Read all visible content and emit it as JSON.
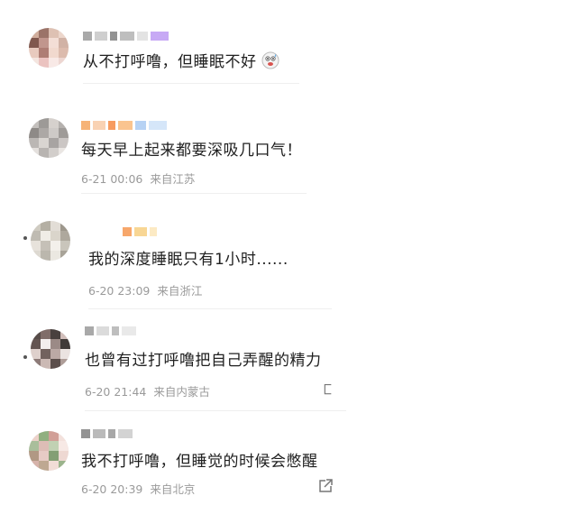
{
  "comments": [
    {
      "text": "从不打呼噜，但睡眠不好",
      "emoji": "grinning-sweat-emoji",
      "time": "",
      "location": "",
      "avatar_colors": [
        "#c9a08c",
        "#8a5b4e",
        "#d9b7a6",
        "#e9cfc2",
        "#6a3b30",
        "#b7847a",
        "#f1d9cf",
        "#caa596",
        "#e4c1b3",
        "#a0675c",
        "#efd3c6",
        "#d7b09f",
        "#f3e1da",
        "#e8b9b6",
        "#f7e6e2",
        "#ebcfc9"
      ],
      "name_colors": [
        "#8c8c8c",
        "#bfbfbf",
        "#6f6f6f",
        "#a8a8a8",
        "#d9d9d9",
        "#b48cf2"
      ]
    },
    {
      "text": "每天早上起来都要深吸几口气！",
      "time": "6-21 00:06",
      "location": "来自江苏",
      "avatar_colors": [
        "#b9b4b1",
        "#8d8986",
        "#cfc9c5",
        "#a9a4a1",
        "#7b7673",
        "#9e9996",
        "#c6c1be",
        "#8f8a87",
        "#b0aba8",
        "#d3ceca",
        "#9a9592",
        "#c2bdba",
        "#e0dbd8",
        "#aca7a4",
        "#cbc6c3",
        "#e7e2df"
      ],
      "name_colors": [
        "#f39a4a",
        "#f7c39a",
        "#f47a2a",
        "#f8b06a",
        "#9dc3f0",
        "#c7ddf7"
      ]
    },
    {
      "text": "我的深度睡眠只有1小时......",
      "time": "6-20 23:09",
      "location": "来自浙江",
      "avatar_colors": [
        "#c7c2b7",
        "#a8a294",
        "#ddd8cf",
        "#8c8679",
        "#b5b0a5",
        "#eeeae2",
        "#d4cec3",
        "#a09a8d",
        "#e3ded5",
        "#bbb6ab",
        "#f2eee8",
        "#c0bbb0",
        "#d8d3ca",
        "#b0ab9f",
        "#e8e4dc",
        "#9a9487"
      ],
      "name_colors": [
        "#f48a3a",
        "#f6c870",
        "#fbe3b0"
      ]
    },
    {
      "text": "也曾有过打呼噜把自己弄醒的精力",
      "time": "6-20 21:44",
      "location": "来自内蒙古",
      "avatar_colors": [
        "#3a2d2a",
        "#6b5450",
        "#2a1f1d",
        "#c9b3ae",
        "#4a3834",
        "#f2ecea",
        "#8a7671",
        "#1f1816",
        "#d9c8c4",
        "#5a4743",
        "#b09b96",
        "#e8dfdc",
        "#7a6561",
        "#c2ada8",
        "#3f302c",
        "#a18c87"
      ],
      "name_colors": [
        "#8c8c8c",
        "#cfcfcf",
        "#a8a8a8",
        "#e2e2e2"
      ]
    },
    {
      "text": "我不打呼噜，但睡觉的时候会憋醒",
      "time": "6-20 20:39",
      "location": "来自北京",
      "avatar_colors": [
        "#e9c9c0",
        "#7da26a",
        "#c98f86",
        "#f2dcd6",
        "#9bb38a",
        "#d8b2aa",
        "#b7c9a6",
        "#f6e6e1",
        "#a4876f",
        "#e3c3bb",
        "#6f8f5c",
        "#ecd2cb",
        "#cfa69c",
        "#b39a7f",
        "#f0d8d1",
        "#8aa878"
      ],
      "name_colors": [
        "#6f6f6f",
        "#a3a3a3",
        "#8a8a8a",
        "#c4c4c4"
      ]
    }
  ]
}
